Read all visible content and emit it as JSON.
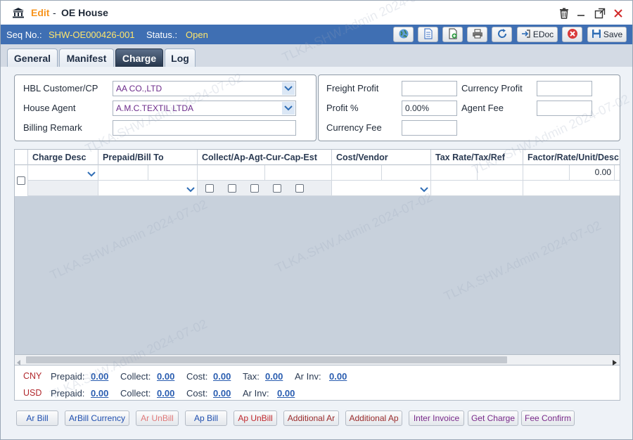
{
  "title": {
    "edit": "Edit",
    "sep": "-",
    "name": "OE House"
  },
  "info": {
    "seq_label": "Seq No.:",
    "seq_value": "SHW-OE000426-001",
    "status_label": "Status.:",
    "status_value": "Open"
  },
  "toolbar": {
    "edoc_label": "EDoc",
    "save_label": "Save"
  },
  "tabs": [
    "General",
    "Manifest",
    "Charge",
    "Log"
  ],
  "active_tab": "Charge",
  "form": {
    "hbl_label": "HBL Customer/CP",
    "hbl_value": "AA CO.,LTD",
    "agent_label": "House Agent",
    "agent_value": "A.M.C.TEXTIL LTDA",
    "remark_label": "Billing Remark",
    "remark_value": "",
    "freight_profit_label": "Freight Profit",
    "freight_profit_value": "",
    "currency_profit_label": "Currency Profit",
    "currency_profit_value": "",
    "profit_pct_label": "Profit %",
    "profit_pct_value": "0.00%",
    "agent_fee_label": "Agent Fee",
    "agent_fee_value": "",
    "currency_fee_label": "Currency Fee",
    "currency_fee_value": ""
  },
  "grid": {
    "headers": [
      "Charge Desc",
      "Prepaid/Bill To",
      "Collect/Ap-Agt-Cur-Cap-Est",
      "Cost/Vendor",
      "Tax Rate/Tax/Ref",
      "Factor/Rate/Unit/Desc"
    ],
    "factor_value": "0.00"
  },
  "totals": {
    "rows": [
      {
        "currency": "CNY",
        "prepaid_label": "Prepaid:",
        "prepaid": "0.00",
        "collect_label": "Collect:",
        "collect": "0.00",
        "cost_label": "Cost:",
        "cost": "0.00",
        "tax_label": "Tax:",
        "tax": "0.00",
        "arinv_label": "Ar Inv:",
        "arinv": "0.00"
      },
      {
        "currency": "USD",
        "prepaid_label": "Prepaid:",
        "prepaid": "0.00",
        "collect_label": "Collect:",
        "collect": "0.00",
        "cost_label": "Cost:",
        "cost": "0.00",
        "arinv_label": "Ar Inv:",
        "arinv": "0.00"
      }
    ]
  },
  "actions": [
    "Ar Bill",
    "ArBill Currency",
    "Ar UnBill",
    "Ap Bill",
    "Ap UnBill",
    "Additional Ar",
    "Additional Ap",
    "Inter Invoice",
    "Get Charge",
    "Fee Confirm"
  ],
  "action_colors": [
    "#1f4fb0",
    "#1f4fb0",
    "#e07a7a",
    "#1f4fb0",
    "#c0282d",
    "#9b2c2c",
    "#9b2c2c",
    "#7a2a8a",
    "#7a2a8a",
    "#7a2a8a"
  ],
  "watermark": "TLKA.SHW.Admin 2024-07-02"
}
